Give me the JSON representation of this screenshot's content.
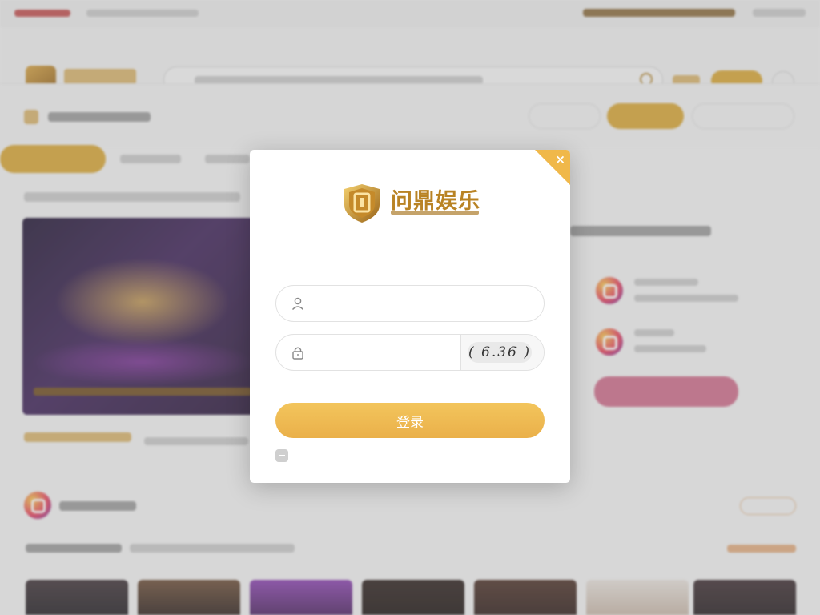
{
  "modal": {
    "brand": "问鼎娱乐",
    "welcome": "",
    "username_placeholder": "",
    "password_placeholder": "",
    "captcha_code": "( 6.36 )",
    "forgot_link": "",
    "login_label": "登录",
    "remember_label": "",
    "register_link": "",
    "close_label": "×"
  },
  "colors": {
    "accent": "#eab04a",
    "link_blue": "#3a8ad6",
    "brand_gold": "#b98324"
  },
  "icons": [
    "close-icon",
    "user-icon",
    "lock-icon",
    "shield-logo-icon",
    "search-icon",
    "app-icon"
  ]
}
